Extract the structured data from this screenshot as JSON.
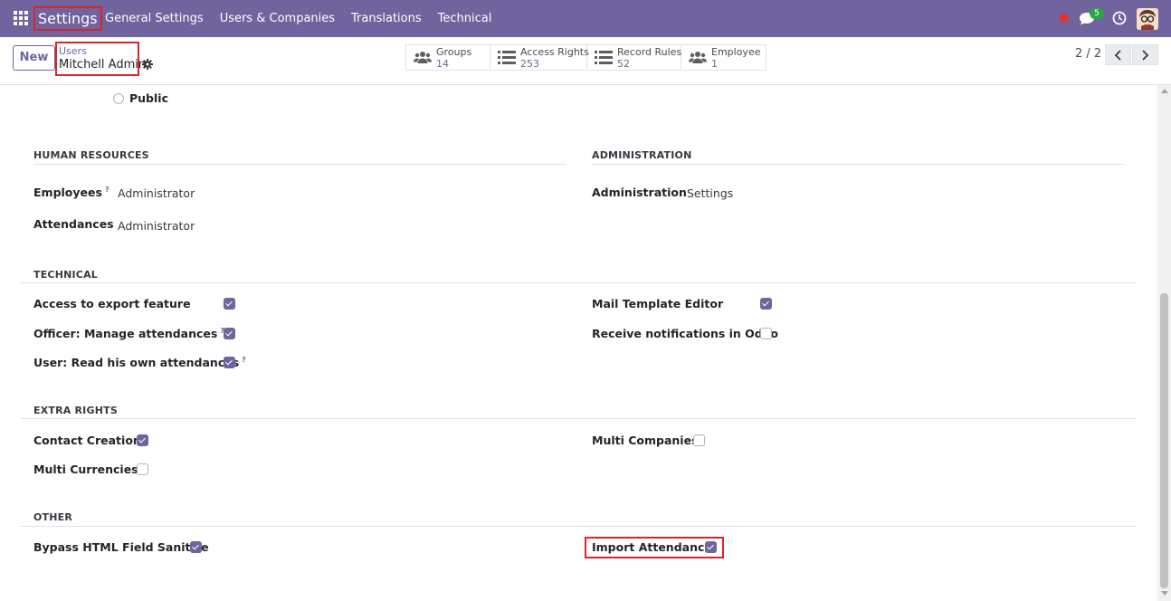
{
  "navbar": {
    "brand": "Settings",
    "menu": [
      "General Settings",
      "Users & Companies",
      "Translations",
      "Technical"
    ],
    "chat_badge": "5",
    "colors": {
      "bar": "#71639e",
      "record": "#e13437",
      "badge": "#28a745"
    }
  },
  "control_panel": {
    "new_button": "New",
    "breadcrumb_parent": "Users",
    "breadcrumb_current": "Mitchell Admin",
    "smart_buttons": [
      {
        "label": "Groups",
        "value": "14",
        "icon": "users-icon"
      },
      {
        "label": "Access Rights",
        "value": "253",
        "icon": "list-icon"
      },
      {
        "label": "Record Rules",
        "value": "52",
        "icon": "list-icon"
      },
      {
        "label": "Employee",
        "value": "1",
        "icon": "users-icon"
      }
    ],
    "pager": "2 / 2"
  },
  "form": {
    "user_type_option": "Public",
    "human_resources": {
      "title": "HUMAN RESOURCES",
      "fields": [
        {
          "label": "Employees",
          "help": "?",
          "value": "Administrator"
        },
        {
          "label": "Attendances",
          "value": "Administrator"
        }
      ]
    },
    "administration": {
      "title": "ADMINISTRATION",
      "fields": [
        {
          "label": "Administration",
          "value": "Settings"
        }
      ]
    },
    "technical": {
      "title": "TECHNICAL",
      "left": [
        {
          "label": "Access to export feature",
          "checked": true
        },
        {
          "label": "Officer: Manage attendances",
          "help": "?",
          "checked": true
        },
        {
          "label": "User: Read his own attendances",
          "help": "?",
          "checked": true
        }
      ],
      "right": [
        {
          "label": "Mail Template Editor",
          "checked": true
        },
        {
          "label": "Receive notifications in Odoo",
          "checked": false
        }
      ]
    },
    "extra_rights": {
      "title": "EXTRA RIGHTS",
      "left": [
        {
          "label": "Contact Creation",
          "checked": true
        },
        {
          "label": "Multi Currencies",
          "checked": false
        }
      ],
      "right": [
        {
          "label": "Multi Companies",
          "checked": false
        }
      ]
    },
    "other": {
      "title": "OTHER",
      "left": [
        {
          "label": "Bypass HTML Field Sanitize",
          "checked": true
        }
      ],
      "right": [
        {
          "label": "Import Attendance",
          "checked": true
        }
      ]
    }
  }
}
